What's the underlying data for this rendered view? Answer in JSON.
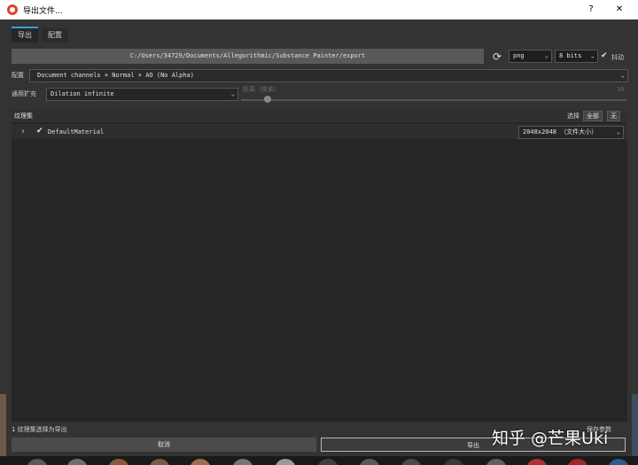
{
  "window": {
    "title": "导出文件...",
    "help": "?",
    "close": "✕"
  },
  "tabs": [
    {
      "label": "导出",
      "active": true
    },
    {
      "label": "配置",
      "active": false
    }
  ],
  "export_path": "C:/Users/34729/Documents/Allegorithmic/Substance Painter/export",
  "format": {
    "value": "png"
  },
  "bit_depth": {
    "value": "8 bits"
  },
  "dithering": {
    "checked": true,
    "label": "抖动"
  },
  "config": {
    "label": "配置",
    "value": "Document channels + Normal + AO (No Alpha)"
  },
  "padding": {
    "label": "通用扩充",
    "value": "Dilation infinite"
  },
  "distance": {
    "label": "距离（像素）",
    "value": "16"
  },
  "texture_sets": {
    "header": "纹理集",
    "select_label": "选择",
    "select_all": "全部",
    "select_none": "无",
    "items": [
      {
        "name": "DefaultMaterial",
        "checked": true,
        "size": "2048x2048 （文件大小）"
      }
    ]
  },
  "status": "1 纹理集选择为导出",
  "save_params": "保存参数",
  "buttons": {
    "cancel": "取消",
    "export": "导出"
  },
  "watermark": "知乎 @芒果Uki"
}
